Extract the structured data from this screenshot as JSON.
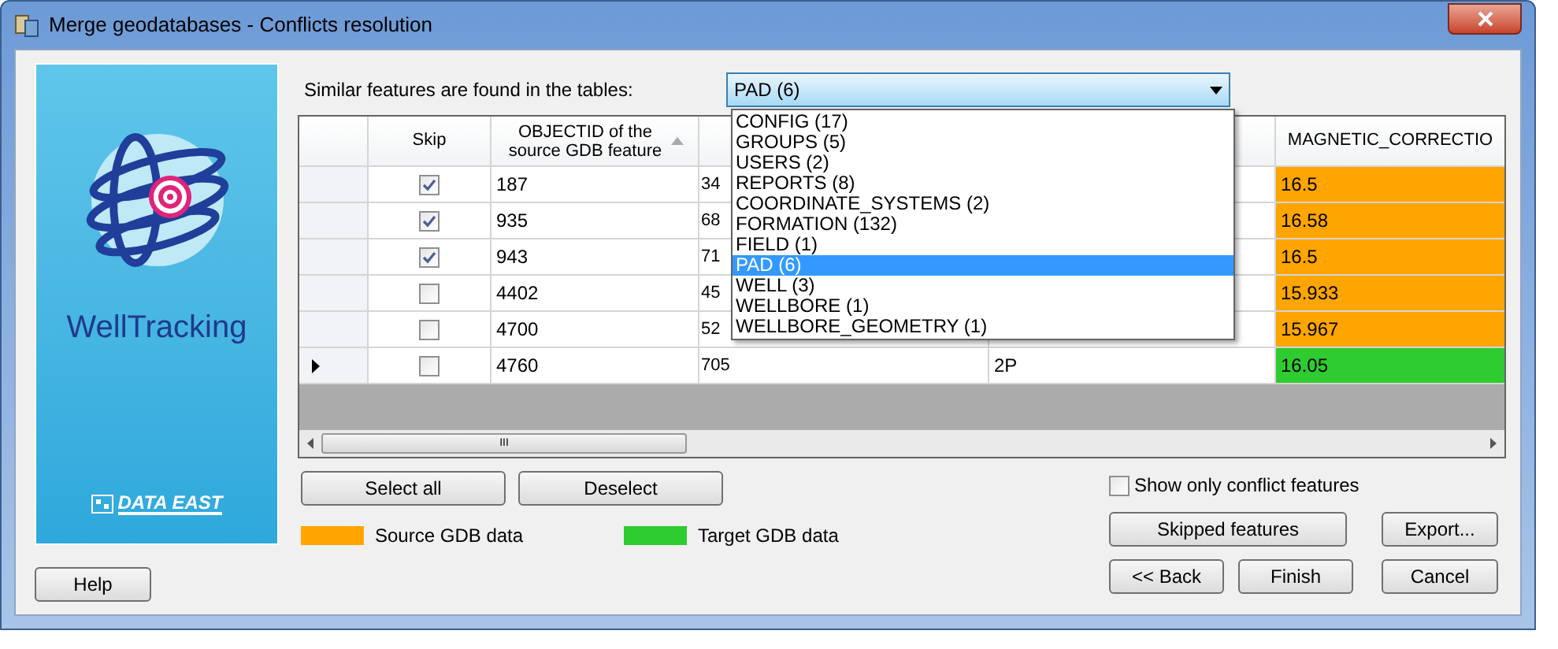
{
  "window": {
    "title": "Merge geodatabases - Conflicts resolution"
  },
  "logo": {
    "product": "WellTracking",
    "company": "DATA EAST"
  },
  "tables_label": "Similar features are found in the tables:",
  "tables_dropdown": {
    "value": "PAD (6)",
    "expanded": true,
    "options": [
      {
        "label": "CONFIG (17)",
        "selected": false
      },
      {
        "label": "GROUPS (5)",
        "selected": false
      },
      {
        "label": "USERS (2)",
        "selected": false
      },
      {
        "label": "REPORTS (8)",
        "selected": false
      },
      {
        "label": "COORDINATE_SYSTEMS (2)",
        "selected": false
      },
      {
        "label": "FORMATION (132)",
        "selected": false
      },
      {
        "label": "FIELD (1)",
        "selected": false
      },
      {
        "label": "PAD (6)",
        "selected": true
      },
      {
        "label": "WELL (3)",
        "selected": false
      },
      {
        "label": "WELLBORE (1)",
        "selected": false
      },
      {
        "label": "WELLBORE_GEOMETRY (1)",
        "selected": false
      }
    ]
  },
  "table": {
    "columns": [
      "Skip",
      "OBJECTID of the source GDB feature",
      "MAGNETIC_CORRECTIO"
    ],
    "rows": [
      {
        "selected": false,
        "checked": true,
        "objectid": "187",
        "column_3": "34",
        "column_4": "",
        "magnetic": "16.5",
        "color": "#ffa500"
      },
      {
        "selected": false,
        "checked": true,
        "objectid": "935",
        "column_3": "68",
        "column_4": "",
        "magnetic": "16.58",
        "color": "#ffa500"
      },
      {
        "selected": false,
        "checked": true,
        "objectid": "943",
        "column_3": "71",
        "column_4": "",
        "magnetic": "16.5",
        "color": "#ffa500"
      },
      {
        "selected": false,
        "checked": false,
        "objectid": "4402",
        "column_3": "45",
        "column_4": "",
        "magnetic": "15.933",
        "color": "#ffa500"
      },
      {
        "selected": false,
        "checked": false,
        "objectid": "4700",
        "column_3": "52",
        "column_4": "",
        "magnetic": "15.967",
        "color": "#ffa500"
      },
      {
        "selected": true,
        "checked": false,
        "objectid": "4760",
        "column_3": "705",
        "column_4": "2P",
        "magnetic": "16.05",
        "color": "#2ecc30"
      }
    ],
    "scrollbar_grip": "III"
  },
  "select_buttons": [
    "Select all",
    "Deselect"
  ],
  "legend": [
    {
      "label": "Source GDB data",
      "color": "#ffa500"
    },
    {
      "label": "Target GDB data",
      "color": "#2ecc30"
    }
  ],
  "show_only_conflicts": {
    "label": "Show only conflict features",
    "checked": false
  },
  "buttons": {
    "help": "Help",
    "skipped": "Skipped features",
    "export": "Export...",
    "back": "<< Back",
    "finish": "Finish",
    "cancel": "Cancel"
  }
}
